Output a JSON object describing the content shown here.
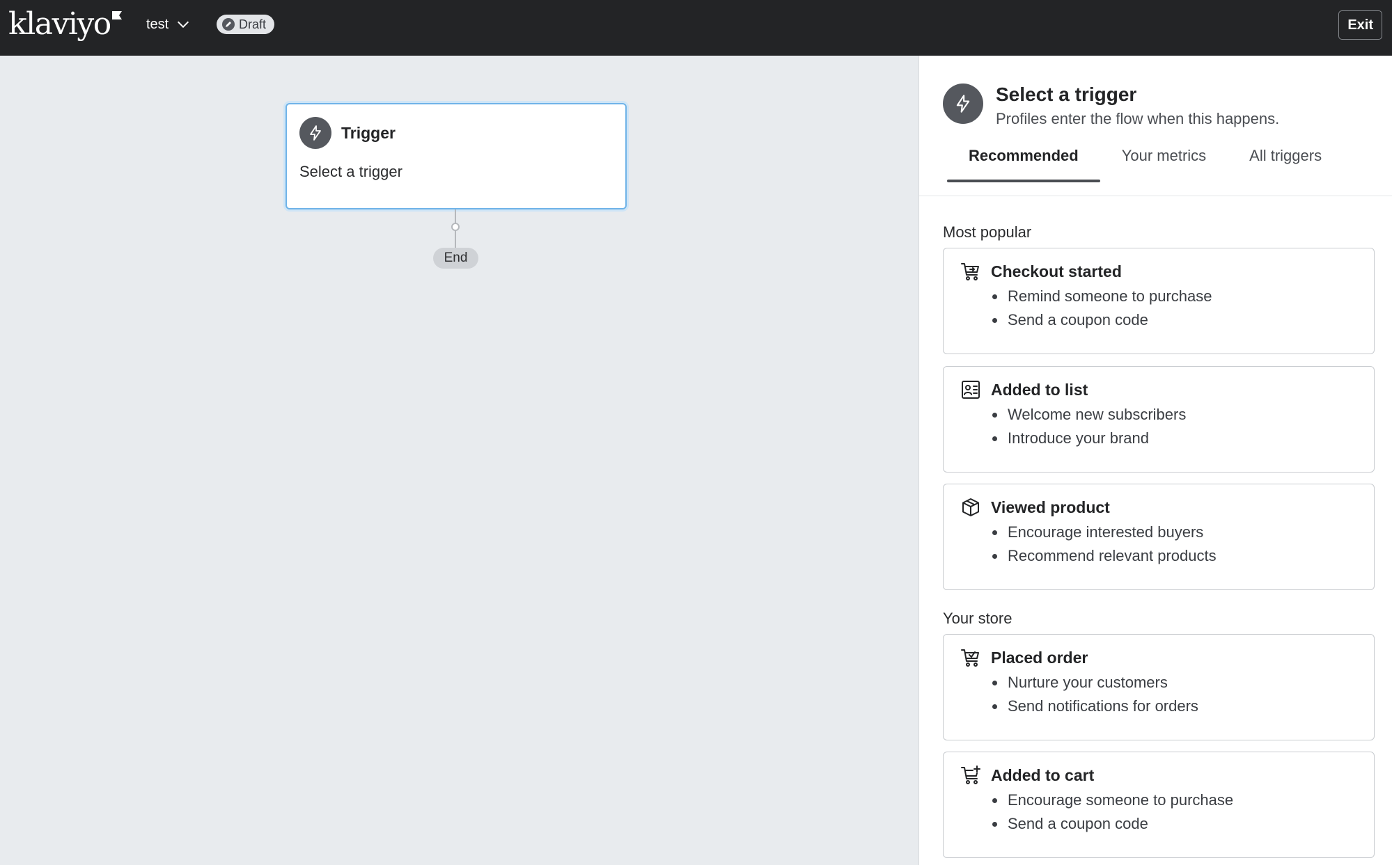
{
  "header": {
    "logo_text": "klaviyo",
    "flow_name": "test",
    "status_badge": "Draft",
    "exit_label": "Exit"
  },
  "canvas": {
    "trigger_node": {
      "title": "Trigger",
      "subtitle": "Select a trigger"
    },
    "end_label": "End"
  },
  "panel": {
    "title": "Select a trigger",
    "subtitle": "Profiles enter the flow when this happens.",
    "tabs": [
      {
        "label": "Recommended",
        "active": true
      },
      {
        "label": "Your metrics",
        "active": false
      },
      {
        "label": "All triggers",
        "active": false
      }
    ],
    "sections": [
      {
        "label": "Most popular",
        "cards": [
          {
            "icon": "cart-arrow-icon",
            "title": "Checkout started",
            "items": [
              "Remind someone to purchase",
              "Send a coupon code"
            ]
          },
          {
            "icon": "contact-list-icon",
            "title": "Added to list",
            "items": [
              "Welcome new subscribers",
              "Introduce your brand"
            ]
          },
          {
            "icon": "box-icon",
            "title": "Viewed product",
            "items": [
              "Encourage interested buyers",
              "Recommend relevant products"
            ]
          }
        ]
      },
      {
        "label": "Your store",
        "cards": [
          {
            "icon": "cart-check-icon",
            "title": "Placed order",
            "items": [
              "Nurture your customers",
              "Send notifications for orders"
            ]
          },
          {
            "icon": "cart-plus-icon",
            "title": "Added to cart",
            "items": [
              "Encourage someone to purchase",
              "Send a coupon code"
            ]
          }
        ]
      }
    ]
  },
  "colors": {
    "topbar": "#232426",
    "canvas_bg": "#e8ebee",
    "selected_border": "#6fb3e8",
    "icon_circle": "#55585e"
  }
}
